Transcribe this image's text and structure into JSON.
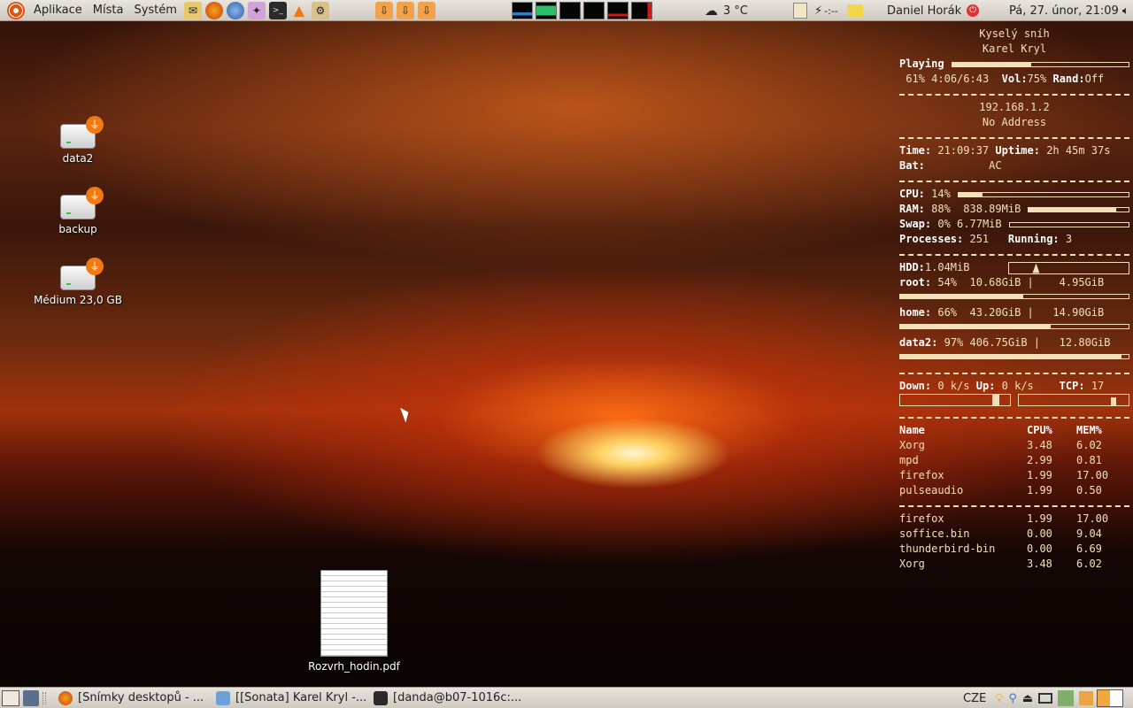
{
  "top_panel": {
    "menus": [
      "Aplikace",
      "Místa",
      "Systém"
    ],
    "weather": "3 °C",
    "battery_text": "-:--",
    "user": "Daniel Horák",
    "clock": "Pá, 27. únor, 21:09"
  },
  "desktop_icons": [
    {
      "label": "data2"
    },
    {
      "label": "backup"
    },
    {
      "label": "Médium 23,0 GB"
    }
  ],
  "pdf_file": {
    "label": "Rozvrh_hodin.pdf"
  },
  "conky": {
    "song_title": "Kyselý sníh",
    "song_artist": "Karel Kryl",
    "playing_label": "Playing",
    "progress_pct": "61%",
    "progress_fraction": 0.45,
    "time_pos": "4:06/6:43",
    "vol_label": "Vol:",
    "vol_value": "75%",
    "rand_label": "Rand:",
    "rand_value": "Off",
    "ip": "192.168.1.2",
    "ip2": "No Address",
    "time_label": "Time:",
    "time_value": "21:09:37",
    "uptime_label": "Uptime:",
    "uptime_value": "2h 45m 37s",
    "bat_label": "Bat:",
    "bat_value": "AC",
    "cpu_label": "CPU:",
    "cpu_value": "14%",
    "cpu_fraction": 0.14,
    "ram_label": "RAM:",
    "ram_value": "88%",
    "ram_used": "838.89MiB",
    "ram_fraction": 0.88,
    "swap_label": "Swap:",
    "swap_value": "0%",
    "swap_used": "6.77MiB",
    "swap_fraction": 0.0,
    "proc_label": "Processes:",
    "proc_value": "251",
    "running_label": "Running:",
    "running_value": "3",
    "hdd_label": "HDD:",
    "hdd_value": "1.04MiB",
    "root_label": "root:",
    "root_pct": "54%",
    "root_used": "10.68GiB",
    "root_free": "4.95GiB",
    "root_fraction": 0.54,
    "home_label": "home:",
    "home_pct": "66%",
    "home_used": "43.20GiB",
    "home_free": "14.90GiB",
    "home_fraction": 0.66,
    "data2_label": "data2:",
    "data2_pct": "97%",
    "data2_used": "406.75GiB",
    "data2_free": "12.80GiB",
    "data2_fraction": 0.97,
    "down_label": "Down:",
    "down_value": "0 k/s",
    "up_label": "Up:",
    "up_value": "0 k/s",
    "tcp_label": "TCP:",
    "tcp_value": "17",
    "proc_header": {
      "name": "Name",
      "cpu": "CPU%",
      "mem": "MEM%"
    },
    "top_cpu": [
      {
        "name": "Xorg",
        "cpu": "3.48",
        "mem": "6.02"
      },
      {
        "name": "mpd",
        "cpu": "2.99",
        "mem": "0.81"
      },
      {
        "name": "firefox",
        "cpu": "1.99",
        "mem": "17.00"
      },
      {
        "name": "pulseaudio",
        "cpu": "1.99",
        "mem": "0.50"
      }
    ],
    "top_mem": [
      {
        "name": "firefox",
        "cpu": "1.99",
        "mem": "17.00"
      },
      {
        "name": "soffice.bin",
        "cpu": "0.00",
        "mem": "9.04"
      },
      {
        "name": "thunderbird-bin",
        "cpu": "0.00",
        "mem": "6.69"
      },
      {
        "name": "Xorg",
        "cpu": "3.48",
        "mem": "6.02"
      }
    ]
  },
  "taskbar": {
    "tasks": [
      "[Snímky desktopů - ...",
      "[[Sonata] Karel Kryl -...",
      "[danda@b07-1016c:..."
    ],
    "keyboard_layout": "CZE"
  },
  "colors": {
    "panel": "#d8d3cb",
    "conky_text": "#f2e0b8",
    "accent_orange": "#f07a12"
  }
}
